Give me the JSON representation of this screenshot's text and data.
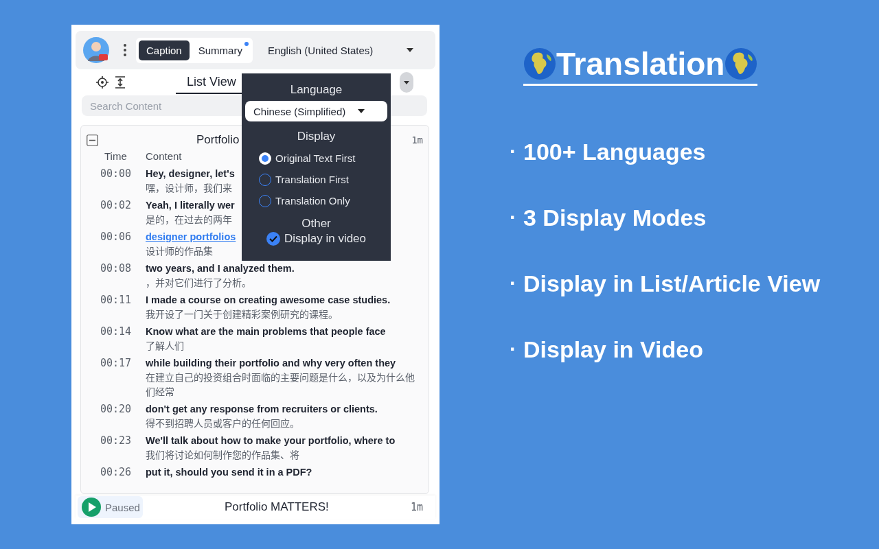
{
  "header": {
    "tabs": [
      {
        "label": "Caption",
        "selected": true,
        "notify": false
      },
      {
        "label": "Summary",
        "selected": false,
        "notify": true
      }
    ],
    "language": "English (United States)"
  },
  "toolbar": {
    "view_tabs": [
      {
        "label": "List View",
        "selected": true
      }
    ]
  },
  "search": {
    "placeholder": "Search Content"
  },
  "transcript": {
    "title": "Portfolio",
    "duration": "1m",
    "expanded": true,
    "columns": [
      "Time",
      "Content"
    ],
    "rows": [
      {
        "time": "00:00",
        "text": "Hey, designer, let's",
        "translation": "嘿，设计师，我们来",
        "kind": "plain"
      },
      {
        "time": "00:02",
        "text": "Yeah, I literally wer",
        "translation": "是的，在过去的两年",
        "kind": "plain"
      },
      {
        "time": "00:06",
        "text": "designer portfolios",
        "translation": "设计师的作品集",
        "kind": "link"
      },
      {
        "time": "00:08",
        "text": "two years, and I analyzed them.",
        "translation": "，并对它们进行了分析。",
        "kind": "plain"
      },
      {
        "time": "00:11",
        "text": "I made a course on creating awesome case studies.",
        "translation": "我开设了一门关于创建精彩案例研究的课程。",
        "kind": "plain"
      },
      {
        "time": "00:14",
        "text": "Know what are the main problems that people face",
        "translation": "了解人们",
        "kind": "plain"
      },
      {
        "time": "00:17",
        "text": "while building their portfolio and why very often they",
        "translation": "在建立自己的投资组合时面临的主要问题是什么，以及为什么他们经常",
        "kind": "plain"
      },
      {
        "time": "00:20",
        "text": "don't get any response from recruiters or clients.",
        "translation": "得不到招聘人员或客户的任何回应。",
        "kind": "plain"
      },
      {
        "time": "00:23",
        "text": "We'll talk about how to make your portfolio, where to",
        "translation": "我们将讨论如何制作您的作品集、将",
        "kind": "plain"
      },
      {
        "time": "00:26",
        "text": "put it, should you send it in a PDF?",
        "kind": "plain"
      }
    ]
  },
  "popup": {
    "language_heading": "Language",
    "language_value": "Chinese (Simplified)",
    "display_heading": "Display",
    "display_options": [
      {
        "label": "Original Text First",
        "selected": true
      },
      {
        "label": "Translation First",
        "selected": false
      },
      {
        "label": "Translation Only",
        "selected": false
      }
    ],
    "other_heading": "Other",
    "other_options": [
      {
        "label": "Display in video",
        "checked": true
      }
    ]
  },
  "player": {
    "status": "Paused",
    "title": "Portfolio MATTERS!",
    "duration": "1m"
  },
  "promo": {
    "title": "Translation",
    "features": [
      {
        "bullet": "·",
        "text": "100+ Languages"
      },
      {
        "bullet": "·",
        "text": "3 Display Modes"
      },
      {
        "bullet": "·",
        "text": "Display in List/Article View"
      },
      {
        "bullet": "·",
        "text": "Display in Video"
      }
    ]
  }
}
